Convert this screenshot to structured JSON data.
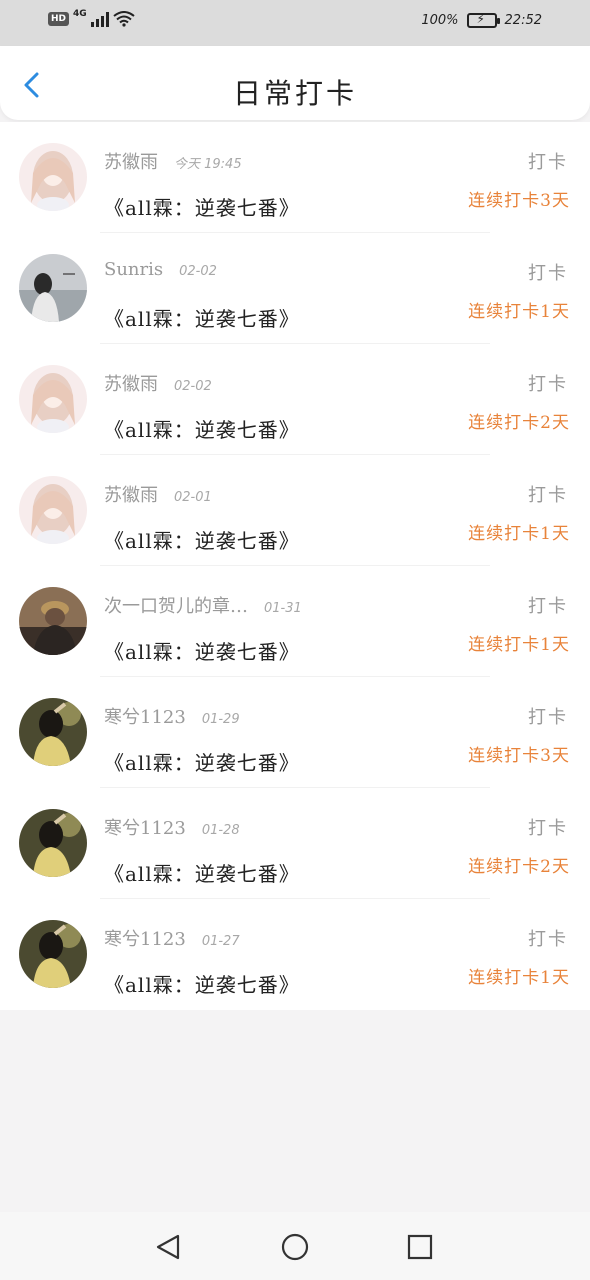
{
  "status_bar": {
    "hd": "HD",
    "network": "4G",
    "battery_percent": "100%",
    "time": "22:52"
  },
  "header": {
    "title": "日常打卡",
    "back_icon": "chevron-left-icon",
    "accent_color": "#2d8ce0"
  },
  "colors": {
    "streak": "#e8833a",
    "muted": "#9a9a9a"
  },
  "checkins": [
    {
      "name": "苏徽雨",
      "date": "今天 19:45",
      "book": "《all霖：逆袭七番》",
      "action": "打卡",
      "streak": "连续打卡3天",
      "avatar": "anime-girl-avatar"
    },
    {
      "name": "Sunris",
      "date": "02-02",
      "book": "《all霖：逆袭七番》",
      "action": "打卡",
      "streak": "连续打卡1天",
      "avatar": "beach-photo-avatar"
    },
    {
      "name": "苏徽雨",
      "date": "02-02",
      "book": "《all霖：逆袭七番》",
      "action": "打卡",
      "streak": "连续打卡2天",
      "avatar": "anime-girl-avatar"
    },
    {
      "name": "苏徽雨",
      "date": "02-01",
      "book": "《all霖：逆袭七番》",
      "action": "打卡",
      "streak": "连续打卡1天",
      "avatar": "anime-girl-avatar"
    },
    {
      "name": "次一口贺儿的章…",
      "date": "01-31",
      "book": "《all霖：逆袭七番》",
      "action": "打卡",
      "streak": "连续打卡1天",
      "avatar": "hat-person-avatar"
    },
    {
      "name": "寒兮1123",
      "date": "01-29",
      "book": "《all霖：逆袭七番》",
      "action": "打卡",
      "streak": "连续打卡3天",
      "avatar": "girl-photo-avatar"
    },
    {
      "name": "寒兮1123",
      "date": "01-28",
      "book": "《all霖：逆袭七番》",
      "action": "打卡",
      "streak": "连续打卡2天",
      "avatar": "girl-photo-avatar"
    },
    {
      "name": "寒兮1123",
      "date": "01-27",
      "book": "《all霖：逆袭七番》",
      "action": "打卡",
      "streak": "连续打卡1天",
      "avatar": "girl-photo-avatar"
    }
  ],
  "nav": {
    "back_icon": "triangle-back-icon",
    "home_icon": "circle-home-icon",
    "recent_icon": "square-recents-icon"
  }
}
